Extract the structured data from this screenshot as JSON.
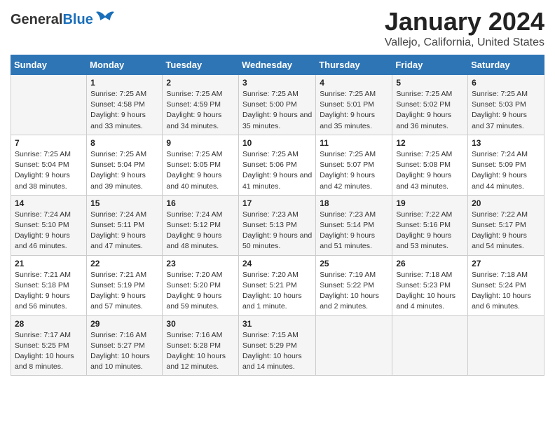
{
  "header": {
    "logo_general": "General",
    "logo_blue": "Blue",
    "main_title": "January 2024",
    "subtitle": "Vallejo, California, United States"
  },
  "weekdays": [
    "Sunday",
    "Monday",
    "Tuesday",
    "Wednesday",
    "Thursday",
    "Friday",
    "Saturday"
  ],
  "weeks": [
    [
      {
        "day": "",
        "sunrise": "",
        "sunset": "",
        "daylight": ""
      },
      {
        "day": "1",
        "sunrise": "Sunrise: 7:25 AM",
        "sunset": "Sunset: 4:58 PM",
        "daylight": "Daylight: 9 hours and 33 minutes."
      },
      {
        "day": "2",
        "sunrise": "Sunrise: 7:25 AM",
        "sunset": "Sunset: 4:59 PM",
        "daylight": "Daylight: 9 hours and 34 minutes."
      },
      {
        "day": "3",
        "sunrise": "Sunrise: 7:25 AM",
        "sunset": "Sunset: 5:00 PM",
        "daylight": "Daylight: 9 hours and 35 minutes."
      },
      {
        "day": "4",
        "sunrise": "Sunrise: 7:25 AM",
        "sunset": "Sunset: 5:01 PM",
        "daylight": "Daylight: 9 hours and 35 minutes."
      },
      {
        "day": "5",
        "sunrise": "Sunrise: 7:25 AM",
        "sunset": "Sunset: 5:02 PM",
        "daylight": "Daylight: 9 hours and 36 minutes."
      },
      {
        "day": "6",
        "sunrise": "Sunrise: 7:25 AM",
        "sunset": "Sunset: 5:03 PM",
        "daylight": "Daylight: 9 hours and 37 minutes."
      }
    ],
    [
      {
        "day": "7",
        "sunrise": "Sunrise: 7:25 AM",
        "sunset": "Sunset: 5:04 PM",
        "daylight": "Daylight: 9 hours and 38 minutes."
      },
      {
        "day": "8",
        "sunrise": "Sunrise: 7:25 AM",
        "sunset": "Sunset: 5:04 PM",
        "daylight": "Daylight: 9 hours and 39 minutes."
      },
      {
        "day": "9",
        "sunrise": "Sunrise: 7:25 AM",
        "sunset": "Sunset: 5:05 PM",
        "daylight": "Daylight: 9 hours and 40 minutes."
      },
      {
        "day": "10",
        "sunrise": "Sunrise: 7:25 AM",
        "sunset": "Sunset: 5:06 PM",
        "daylight": "Daylight: 9 hours and 41 minutes."
      },
      {
        "day": "11",
        "sunrise": "Sunrise: 7:25 AM",
        "sunset": "Sunset: 5:07 PM",
        "daylight": "Daylight: 9 hours and 42 minutes."
      },
      {
        "day": "12",
        "sunrise": "Sunrise: 7:25 AM",
        "sunset": "Sunset: 5:08 PM",
        "daylight": "Daylight: 9 hours and 43 minutes."
      },
      {
        "day": "13",
        "sunrise": "Sunrise: 7:24 AM",
        "sunset": "Sunset: 5:09 PM",
        "daylight": "Daylight: 9 hours and 44 minutes."
      }
    ],
    [
      {
        "day": "14",
        "sunrise": "Sunrise: 7:24 AM",
        "sunset": "Sunset: 5:10 PM",
        "daylight": "Daylight: 9 hours and 46 minutes."
      },
      {
        "day": "15",
        "sunrise": "Sunrise: 7:24 AM",
        "sunset": "Sunset: 5:11 PM",
        "daylight": "Daylight: 9 hours and 47 minutes."
      },
      {
        "day": "16",
        "sunrise": "Sunrise: 7:24 AM",
        "sunset": "Sunset: 5:12 PM",
        "daylight": "Daylight: 9 hours and 48 minutes."
      },
      {
        "day": "17",
        "sunrise": "Sunrise: 7:23 AM",
        "sunset": "Sunset: 5:13 PM",
        "daylight": "Daylight: 9 hours and 50 minutes."
      },
      {
        "day": "18",
        "sunrise": "Sunrise: 7:23 AM",
        "sunset": "Sunset: 5:14 PM",
        "daylight": "Daylight: 9 hours and 51 minutes."
      },
      {
        "day": "19",
        "sunrise": "Sunrise: 7:22 AM",
        "sunset": "Sunset: 5:16 PM",
        "daylight": "Daylight: 9 hours and 53 minutes."
      },
      {
        "day": "20",
        "sunrise": "Sunrise: 7:22 AM",
        "sunset": "Sunset: 5:17 PM",
        "daylight": "Daylight: 9 hours and 54 minutes."
      }
    ],
    [
      {
        "day": "21",
        "sunrise": "Sunrise: 7:21 AM",
        "sunset": "Sunset: 5:18 PM",
        "daylight": "Daylight: 9 hours and 56 minutes."
      },
      {
        "day": "22",
        "sunrise": "Sunrise: 7:21 AM",
        "sunset": "Sunset: 5:19 PM",
        "daylight": "Daylight: 9 hours and 57 minutes."
      },
      {
        "day": "23",
        "sunrise": "Sunrise: 7:20 AM",
        "sunset": "Sunset: 5:20 PM",
        "daylight": "Daylight: 9 hours and 59 minutes."
      },
      {
        "day": "24",
        "sunrise": "Sunrise: 7:20 AM",
        "sunset": "Sunset: 5:21 PM",
        "daylight": "Daylight: 10 hours and 1 minute."
      },
      {
        "day": "25",
        "sunrise": "Sunrise: 7:19 AM",
        "sunset": "Sunset: 5:22 PM",
        "daylight": "Daylight: 10 hours and 2 minutes."
      },
      {
        "day": "26",
        "sunrise": "Sunrise: 7:18 AM",
        "sunset": "Sunset: 5:23 PM",
        "daylight": "Daylight: 10 hours and 4 minutes."
      },
      {
        "day": "27",
        "sunrise": "Sunrise: 7:18 AM",
        "sunset": "Sunset: 5:24 PM",
        "daylight": "Daylight: 10 hours and 6 minutes."
      }
    ],
    [
      {
        "day": "28",
        "sunrise": "Sunrise: 7:17 AM",
        "sunset": "Sunset: 5:25 PM",
        "daylight": "Daylight: 10 hours and 8 minutes."
      },
      {
        "day": "29",
        "sunrise": "Sunrise: 7:16 AM",
        "sunset": "Sunset: 5:27 PM",
        "daylight": "Daylight: 10 hours and 10 minutes."
      },
      {
        "day": "30",
        "sunrise": "Sunrise: 7:16 AM",
        "sunset": "Sunset: 5:28 PM",
        "daylight": "Daylight: 10 hours and 12 minutes."
      },
      {
        "day": "31",
        "sunrise": "Sunrise: 7:15 AM",
        "sunset": "Sunset: 5:29 PM",
        "daylight": "Daylight: 10 hours and 14 minutes."
      },
      {
        "day": "",
        "sunrise": "",
        "sunset": "",
        "daylight": ""
      },
      {
        "day": "",
        "sunrise": "",
        "sunset": "",
        "daylight": ""
      },
      {
        "day": "",
        "sunrise": "",
        "sunset": "",
        "daylight": ""
      }
    ]
  ]
}
